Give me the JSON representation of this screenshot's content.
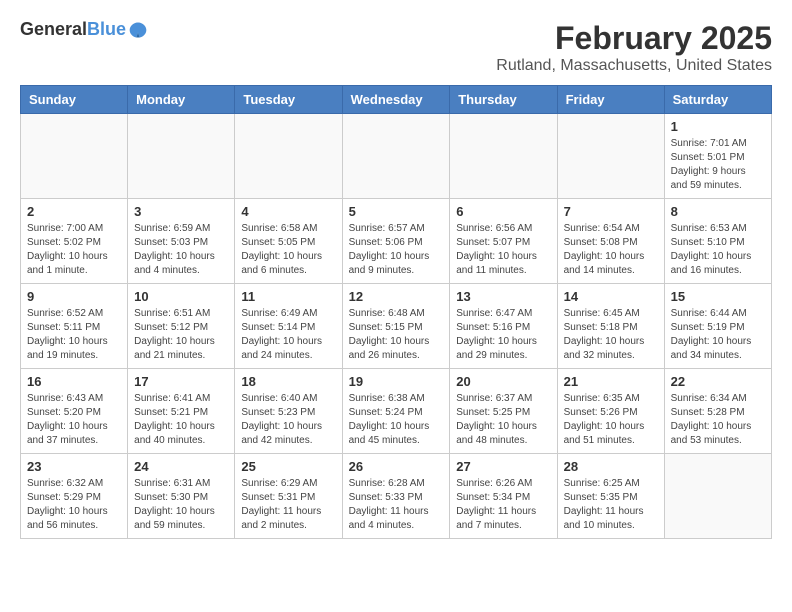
{
  "logo": {
    "line1": "General",
    "line2": "Blue"
  },
  "title": "February 2025",
  "location": "Rutland, Massachusetts, United States",
  "days_of_week": [
    "Sunday",
    "Monday",
    "Tuesday",
    "Wednesday",
    "Thursday",
    "Friday",
    "Saturday"
  ],
  "weeks": [
    [
      {
        "day": "",
        "info": ""
      },
      {
        "day": "",
        "info": ""
      },
      {
        "day": "",
        "info": ""
      },
      {
        "day": "",
        "info": ""
      },
      {
        "day": "",
        "info": ""
      },
      {
        "day": "",
        "info": ""
      },
      {
        "day": "1",
        "info": "Sunrise: 7:01 AM\nSunset: 5:01 PM\nDaylight: 9 hours and 59 minutes."
      }
    ],
    [
      {
        "day": "2",
        "info": "Sunrise: 7:00 AM\nSunset: 5:02 PM\nDaylight: 10 hours and 1 minute."
      },
      {
        "day": "3",
        "info": "Sunrise: 6:59 AM\nSunset: 5:03 PM\nDaylight: 10 hours and 4 minutes."
      },
      {
        "day": "4",
        "info": "Sunrise: 6:58 AM\nSunset: 5:05 PM\nDaylight: 10 hours and 6 minutes."
      },
      {
        "day": "5",
        "info": "Sunrise: 6:57 AM\nSunset: 5:06 PM\nDaylight: 10 hours and 9 minutes."
      },
      {
        "day": "6",
        "info": "Sunrise: 6:56 AM\nSunset: 5:07 PM\nDaylight: 10 hours and 11 minutes."
      },
      {
        "day": "7",
        "info": "Sunrise: 6:54 AM\nSunset: 5:08 PM\nDaylight: 10 hours and 14 minutes."
      },
      {
        "day": "8",
        "info": "Sunrise: 6:53 AM\nSunset: 5:10 PM\nDaylight: 10 hours and 16 minutes."
      }
    ],
    [
      {
        "day": "9",
        "info": "Sunrise: 6:52 AM\nSunset: 5:11 PM\nDaylight: 10 hours and 19 minutes."
      },
      {
        "day": "10",
        "info": "Sunrise: 6:51 AM\nSunset: 5:12 PM\nDaylight: 10 hours and 21 minutes."
      },
      {
        "day": "11",
        "info": "Sunrise: 6:49 AM\nSunset: 5:14 PM\nDaylight: 10 hours and 24 minutes."
      },
      {
        "day": "12",
        "info": "Sunrise: 6:48 AM\nSunset: 5:15 PM\nDaylight: 10 hours and 26 minutes."
      },
      {
        "day": "13",
        "info": "Sunrise: 6:47 AM\nSunset: 5:16 PM\nDaylight: 10 hours and 29 minutes."
      },
      {
        "day": "14",
        "info": "Sunrise: 6:45 AM\nSunset: 5:18 PM\nDaylight: 10 hours and 32 minutes."
      },
      {
        "day": "15",
        "info": "Sunrise: 6:44 AM\nSunset: 5:19 PM\nDaylight: 10 hours and 34 minutes."
      }
    ],
    [
      {
        "day": "16",
        "info": "Sunrise: 6:43 AM\nSunset: 5:20 PM\nDaylight: 10 hours and 37 minutes."
      },
      {
        "day": "17",
        "info": "Sunrise: 6:41 AM\nSunset: 5:21 PM\nDaylight: 10 hours and 40 minutes."
      },
      {
        "day": "18",
        "info": "Sunrise: 6:40 AM\nSunset: 5:23 PM\nDaylight: 10 hours and 42 minutes."
      },
      {
        "day": "19",
        "info": "Sunrise: 6:38 AM\nSunset: 5:24 PM\nDaylight: 10 hours and 45 minutes."
      },
      {
        "day": "20",
        "info": "Sunrise: 6:37 AM\nSunset: 5:25 PM\nDaylight: 10 hours and 48 minutes."
      },
      {
        "day": "21",
        "info": "Sunrise: 6:35 AM\nSunset: 5:26 PM\nDaylight: 10 hours and 51 minutes."
      },
      {
        "day": "22",
        "info": "Sunrise: 6:34 AM\nSunset: 5:28 PM\nDaylight: 10 hours and 53 minutes."
      }
    ],
    [
      {
        "day": "23",
        "info": "Sunrise: 6:32 AM\nSunset: 5:29 PM\nDaylight: 10 hours and 56 minutes."
      },
      {
        "day": "24",
        "info": "Sunrise: 6:31 AM\nSunset: 5:30 PM\nDaylight: 10 hours and 59 minutes."
      },
      {
        "day": "25",
        "info": "Sunrise: 6:29 AM\nSunset: 5:31 PM\nDaylight: 11 hours and 2 minutes."
      },
      {
        "day": "26",
        "info": "Sunrise: 6:28 AM\nSunset: 5:33 PM\nDaylight: 11 hours and 4 minutes."
      },
      {
        "day": "27",
        "info": "Sunrise: 6:26 AM\nSunset: 5:34 PM\nDaylight: 11 hours and 7 minutes."
      },
      {
        "day": "28",
        "info": "Sunrise: 6:25 AM\nSunset: 5:35 PM\nDaylight: 11 hours and 10 minutes."
      },
      {
        "day": "",
        "info": ""
      }
    ]
  ]
}
